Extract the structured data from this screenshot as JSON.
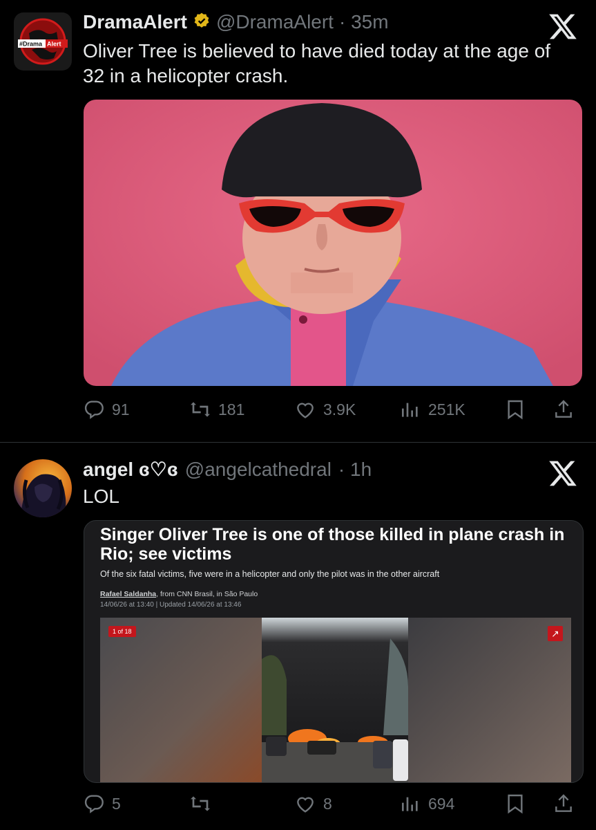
{
  "tweets": [
    {
      "avatar_label": "#Drama Alert",
      "avatar_label_parts": [
        "#Drama",
        "Alert"
      ],
      "name": "DramaAlert",
      "handle": "@DramaAlert",
      "time": "· 35m",
      "verified": true,
      "text_lines": [
        "Oliver Tree is believed to have died today at the age of",
        "32 in a helicopter crash."
      ],
      "stats": {
        "replies": "91",
        "reposts": "181",
        "likes": "3.9K",
        "views": "251K"
      }
    },
    {
      "name": "angel ɞ♡ɞ",
      "handle": "@angelcathedral",
      "time": "· 1h",
      "text": "LOL",
      "card": {
        "headline": "Singer Oliver Tree is one of those killed in plane crash in Rio; see victims",
        "subtitle": "Of the six fatal victims, five were in a helicopter and only the pilot was in the other aircraft",
        "author": "Rafael Saldanha",
        "author_rest": ", from CNN Brasil, in São Paulo",
        "date": "14/06/26 at 13:40 | Updated 14/06/26 at 13:46",
        "gallery_badge": "1 of 18",
        "expand_icon": "↗"
      },
      "stats": {
        "replies": "5",
        "reposts": "",
        "likes": "8",
        "views": "694"
      }
    }
  ],
  "icons": {
    "close": "𝕏",
    "reply": "reply-icon",
    "repost": "repost-icon",
    "like": "like-icon",
    "views": "views-icon",
    "bookmark": "bookmark-icon",
    "share": "share-icon"
  },
  "colors": {
    "background": "#000000",
    "verified": "#e2b719",
    "muted": "#71767b",
    "photo_bg": "#e0607e",
    "cnn_red": "#c4161c"
  }
}
